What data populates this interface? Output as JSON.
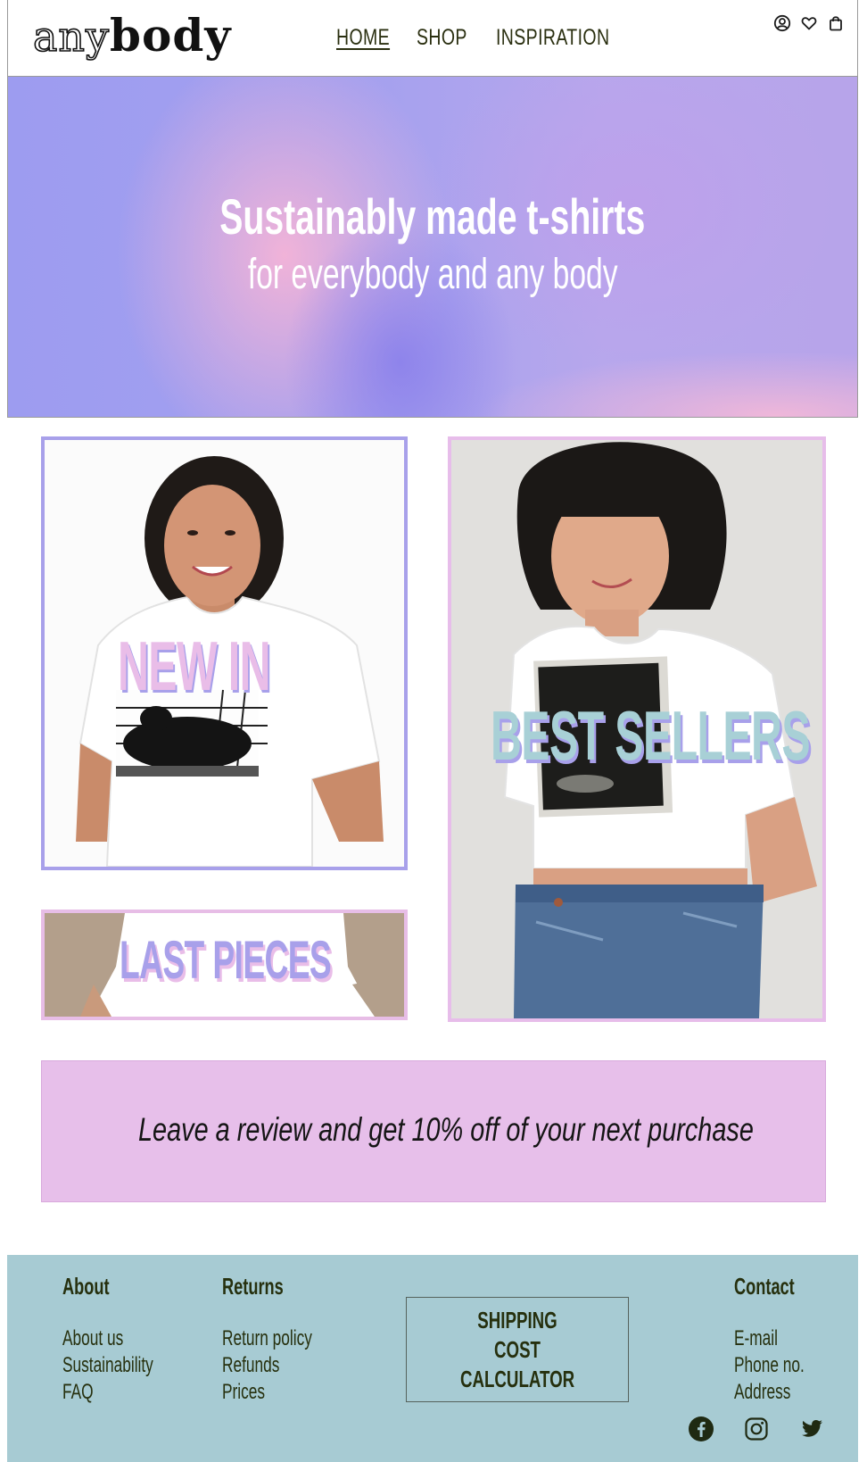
{
  "header": {
    "logo_part1": "any",
    "logo_part2": "body",
    "nav": [
      {
        "label": "HOME",
        "active": true
      },
      {
        "label": "SHOP",
        "active": false
      },
      {
        "label": "INSPIRATION",
        "active": false
      }
    ],
    "icons": [
      "user-icon",
      "heart-icon",
      "shopping-bag-icon"
    ]
  },
  "hero": {
    "title": "Sustainably made t-shirts",
    "subtitle": "for everybody and any body"
  },
  "tiles": {
    "new_in": {
      "label": "NEW IN",
      "color": "#e9bde8",
      "shadow": "#a8a0ea"
    },
    "best_sellers": {
      "label": "BEST SELLERS",
      "color": "#a8d0d6",
      "shadow": "#a8a0ea"
    },
    "last_pieces": {
      "label": "LAST PIECES",
      "color": "#a8a0ea",
      "shadow": "#e9bde8"
    }
  },
  "promo": {
    "text": "Leave a review and get 10% off of your next purchase"
  },
  "footer": {
    "about": {
      "heading": "About",
      "links": [
        "About us",
        "Sustainability",
        "FAQ"
      ]
    },
    "returns": {
      "heading": "Returns",
      "links": [
        "Return policy",
        "Refunds",
        "Prices"
      ]
    },
    "shipping_button": {
      "line1": "SHIPPING COST",
      "line2": "CALCULATOR"
    },
    "contact": {
      "heading": "Contact",
      "links": [
        "E-mail",
        "Phone no.",
        "Address"
      ]
    },
    "social_icons": [
      "facebook-icon",
      "instagram-icon",
      "twitter-icon"
    ]
  },
  "colors": {
    "lavender": "#a8a0ea",
    "pink": "#e7bfea",
    "footer_bg": "#a7cbd3",
    "text_dark": "#26300e"
  }
}
